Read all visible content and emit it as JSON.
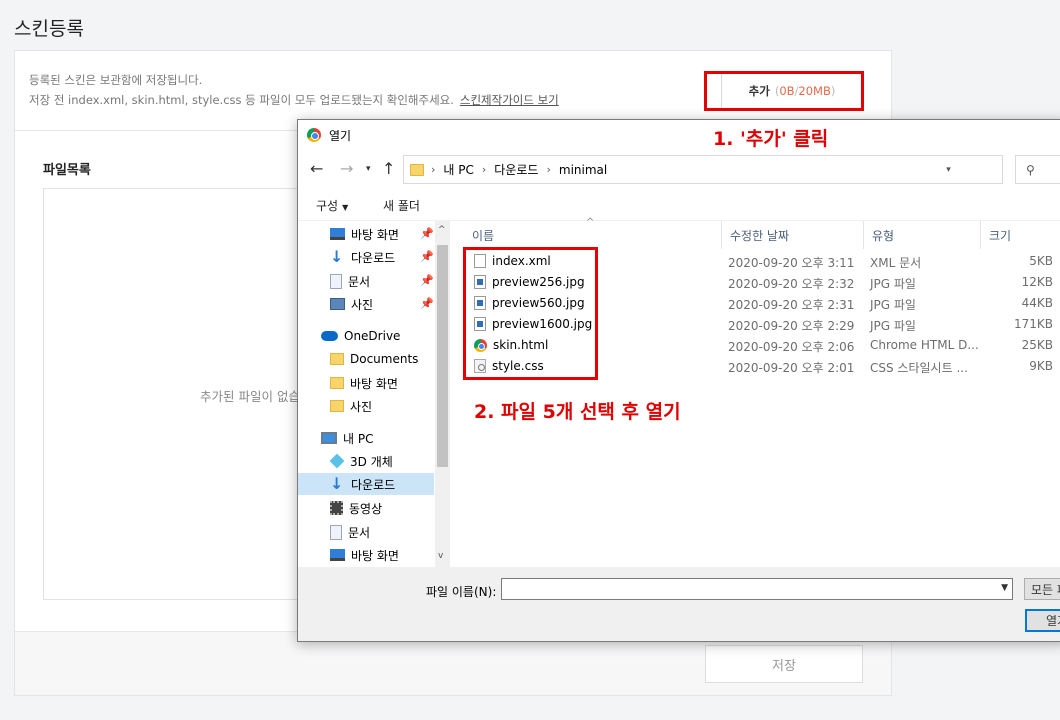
{
  "page": {
    "title": "스킨등록",
    "notice_line1": "등록된 스킨은 보관함에 저장됩니다.",
    "notice_line2": "저장 전 index.xml, skin.html, style.css 등 파일이 모두 업로드됐는지 확인해주세요.",
    "guide_link": "스킨제작가이드 보기",
    "add_label": "추가",
    "add_used": "0B",
    "add_sep": "/",
    "add_limit": "20MB",
    "paren_open": "(",
    "paren_close": ")",
    "file_list_title": "파일목록",
    "file_empty": "추가된 파일이 없습니",
    "save_label": "저장"
  },
  "dialog": {
    "title": "열기",
    "path": [
      "내 PC",
      "다운로드",
      "minimal"
    ],
    "search_placeholder": "ᅟ m",
    "organize": "구성",
    "new_folder": "새 폴더",
    "nav_items": [
      {
        "label": "바탕 화면",
        "icon": "desktop-icon"
      },
      {
        "label": "다운로드",
        "icon": "download-icon"
      },
      {
        "label": "문서",
        "icon": "document-icon"
      },
      {
        "label": "사진",
        "icon": "pictures-icon"
      },
      {
        "label": "OneDrive",
        "icon": "cloud-icon"
      },
      {
        "label": "Documents",
        "icon": "folder-icon"
      },
      {
        "label": "바탕 화면",
        "icon": "folder-icon"
      },
      {
        "label": "사진",
        "icon": "folder-icon"
      },
      {
        "label": "내 PC",
        "icon": "pc-icon"
      },
      {
        "label": "3D 개체",
        "icon": "3d-object-icon"
      },
      {
        "label": "다운로드",
        "icon": "download-icon"
      },
      {
        "label": "동영상",
        "icon": "video-icon"
      },
      {
        "label": "문서",
        "icon": "document-icon"
      },
      {
        "label": "바탕 화면",
        "icon": "desktop-icon"
      }
    ],
    "columns": {
      "name": "이름",
      "date": "수정한 날짜",
      "type": "유형",
      "size": "크기"
    },
    "files": [
      {
        "name": "index.xml",
        "date": "2020-09-20 오후 3:11",
        "type": "XML 문서",
        "size": "5KB",
        "icon": "xml-file-icon"
      },
      {
        "name": "preview256.jpg",
        "date": "2020-09-20 오후 2:32",
        "type": "JPG 파일",
        "size": "12KB",
        "icon": "image-file-icon"
      },
      {
        "name": "preview560.jpg",
        "date": "2020-09-20 오후 2:31",
        "type": "JPG 파일",
        "size": "44KB",
        "icon": "image-file-icon"
      },
      {
        "name": "preview1600.jpg",
        "date": "2020-09-20 오후 2:29",
        "type": "JPG 파일",
        "size": "171KB",
        "icon": "image-file-icon"
      },
      {
        "name": "skin.html",
        "date": "2020-09-20 오후 2:06",
        "type": "Chrome HTML D...",
        "size": "25KB",
        "icon": "chrome-file-icon"
      },
      {
        "name": "style.css",
        "date": "2020-09-20 오후 2:01",
        "type": "CSS 스타일시트 ...",
        "size": "9KB",
        "icon": "css-file-icon"
      }
    ],
    "filename_label": "파일 이름(N):",
    "filename_value": "",
    "filter_label": "모든 파",
    "open_label": "열기"
  },
  "annotations": {
    "step1": "1. '추가' 클릭",
    "step2": "2. 파일 5개 선택 후 열기"
  },
  "colors": {
    "annotation": "#e60000",
    "accent": "#0078d7",
    "capacity": "#e06a4a"
  }
}
